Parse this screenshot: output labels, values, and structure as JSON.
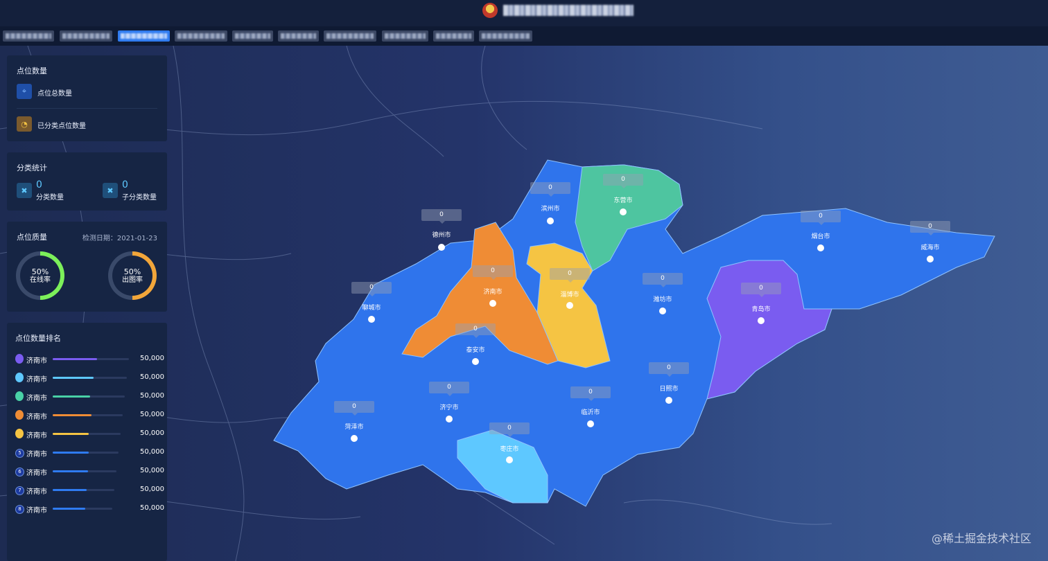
{
  "header": {
    "title_blurred": "████████ ██████"
  },
  "nav": {
    "tabs": [
      {
        "label": "██████"
      },
      {
        "label": "██████"
      },
      {
        "label": "██████",
        "active": true
      },
      {
        "label": "██████"
      },
      {
        "label": "██████"
      },
      {
        "label": "██████"
      },
      {
        "label": "██████"
      },
      {
        "label": "██████"
      },
      {
        "label": "██████"
      },
      {
        "label": "██████"
      }
    ]
  },
  "point_count": {
    "title": "点位数量",
    "total_label": "点位总数量",
    "classified_label": "已分类点位数量"
  },
  "category_stats": {
    "title": "分类统计",
    "items": [
      {
        "value": "0",
        "label": "分类数量"
      },
      {
        "value": "0",
        "label": "子分类数量"
      }
    ]
  },
  "quality": {
    "title": "点位质量",
    "date": "检测日期：2021-01-23",
    "rings": [
      {
        "percent": "50%",
        "label": "在线率",
        "fraction": 0.5,
        "color": "#7cf05a"
      },
      {
        "percent": "50%",
        "label": "出图率",
        "fraction": 0.5,
        "color": "#f2a63a"
      }
    ]
  },
  "ranking": {
    "title": "点位数量排名",
    "rows": [
      {
        "rank": "1",
        "name": "济南市",
        "value": "50,000",
        "fill": 0.58,
        "color": "#7a5cf0"
      },
      {
        "rank": "2",
        "name": "济南市",
        "value": "50,000",
        "fill": 0.55,
        "color": "#5ec8ff"
      },
      {
        "rank": "3",
        "name": "济南市",
        "value": "50,000",
        "fill": 0.52,
        "color": "#49d1a6"
      },
      {
        "rank": "4",
        "name": "济南市",
        "value": "50,000",
        "fill": 0.55,
        "color": "#ef8c35"
      },
      {
        "rank": "5",
        "name": "济南市",
        "value": "50,000",
        "fill": 0.53,
        "color": "#f5c443"
      },
      {
        "rank": "5",
        "name": "济南市",
        "value": "50,000",
        "fill": 0.55,
        "color": "#2f7bf0"
      },
      {
        "rank": "6",
        "name": "济南市",
        "value": "50,000",
        "fill": 0.55,
        "color": "#2f7bf0"
      },
      {
        "rank": "7",
        "name": "济南市",
        "value": "50,000",
        "fill": 0.55,
        "color": "#2f7bf0"
      },
      {
        "rank": "8",
        "name": "济南市",
        "value": "50,000",
        "fill": 0.55,
        "color": "#2f7bf0"
      }
    ]
  },
  "map": {
    "cities": [
      {
        "name": "德州市",
        "value": "0"
      },
      {
        "name": "滨州市",
        "value": "0"
      },
      {
        "name": "东营市",
        "value": "0"
      },
      {
        "name": "烟台市",
        "value": "0"
      },
      {
        "name": "威海市",
        "value": "0"
      },
      {
        "name": "济南市",
        "value": "0"
      },
      {
        "name": "淄博市",
        "value": "0"
      },
      {
        "name": "潍坊市",
        "value": "0"
      },
      {
        "name": "聊城市",
        "value": "0"
      },
      {
        "name": "青岛市",
        "value": "0"
      },
      {
        "name": "泰安市",
        "value": "0"
      },
      {
        "name": "日照市",
        "value": "0"
      },
      {
        "name": "济宁市",
        "value": "0"
      },
      {
        "name": "临沂市",
        "value": "0"
      },
      {
        "name": "菏泽市",
        "value": "0"
      },
      {
        "name": "枣庄市",
        "value": "0"
      }
    ]
  },
  "watermark": "@稀土掘金技术社区"
}
